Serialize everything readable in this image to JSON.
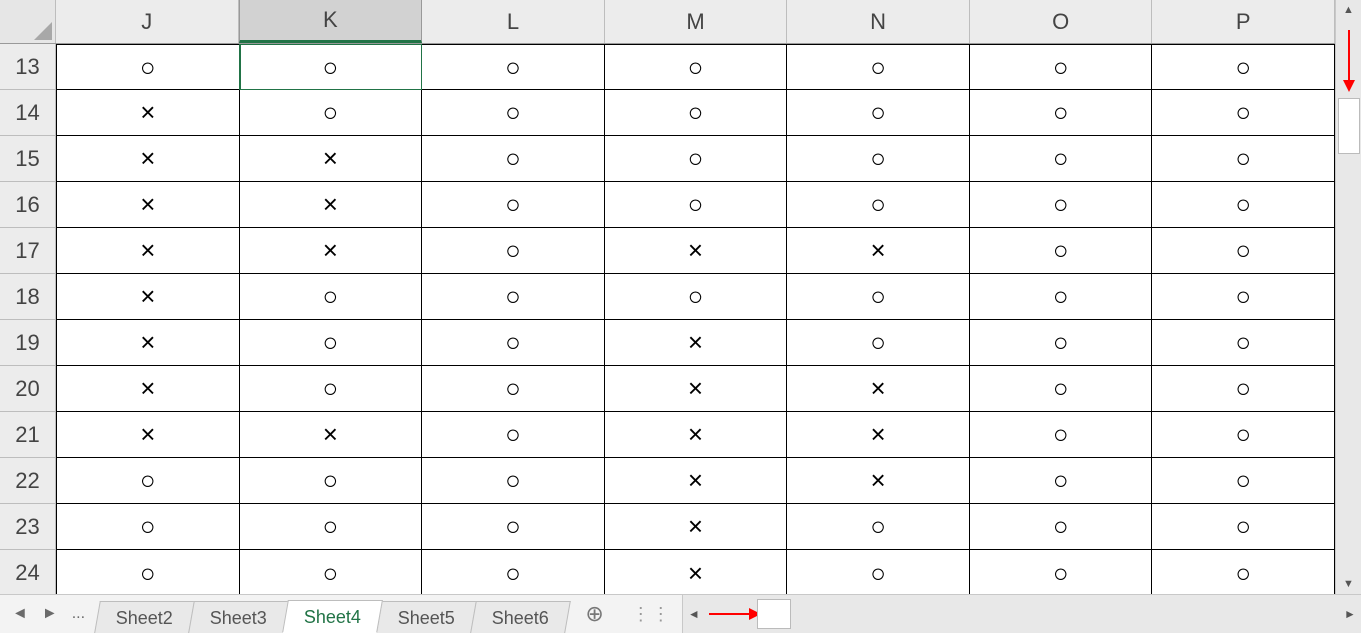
{
  "symbols": {
    "circle": "○",
    "cross": "×"
  },
  "columns": [
    "J",
    "K",
    "L",
    "M",
    "N",
    "O",
    "P"
  ],
  "selected_column": "K",
  "rows": [
    {
      "n": 13,
      "cells": [
        "○",
        "○",
        "○",
        "○",
        "○",
        "○",
        "○"
      ]
    },
    {
      "n": 14,
      "cells": [
        "×",
        "○",
        "○",
        "○",
        "○",
        "○",
        "○"
      ]
    },
    {
      "n": 15,
      "cells": [
        "×",
        "×",
        "○",
        "○",
        "○",
        "○",
        "○"
      ]
    },
    {
      "n": 16,
      "cells": [
        "×",
        "×",
        "○",
        "○",
        "○",
        "○",
        "○"
      ]
    },
    {
      "n": 17,
      "cells": [
        "×",
        "×",
        "○",
        "×",
        "×",
        "○",
        "○"
      ]
    },
    {
      "n": 18,
      "cells": [
        "×",
        "○",
        "○",
        "○",
        "○",
        "○",
        "○"
      ]
    },
    {
      "n": 19,
      "cells": [
        "×",
        "○",
        "○",
        "×",
        "○",
        "○",
        "○"
      ]
    },
    {
      "n": 20,
      "cells": [
        "×",
        "○",
        "○",
        "×",
        "×",
        "○",
        "○"
      ]
    },
    {
      "n": 21,
      "cells": [
        "×",
        "×",
        "○",
        "×",
        "×",
        "○",
        "○"
      ]
    },
    {
      "n": 22,
      "cells": [
        "○",
        "○",
        "○",
        "×",
        "×",
        "○",
        "○"
      ]
    },
    {
      "n": 23,
      "cells": [
        "○",
        "○",
        "○",
        "×",
        "○",
        "○",
        "○"
      ]
    },
    {
      "n": 24,
      "cells": [
        "○",
        "○",
        "○",
        "×",
        "○",
        "○",
        "○"
      ]
    }
  ],
  "tabs": {
    "items": [
      "Sheet2",
      "Sheet3",
      "Sheet4",
      "Sheet5",
      "Sheet6"
    ],
    "active": "Sheet4",
    "overflow_label": "...",
    "add_label": "+"
  }
}
